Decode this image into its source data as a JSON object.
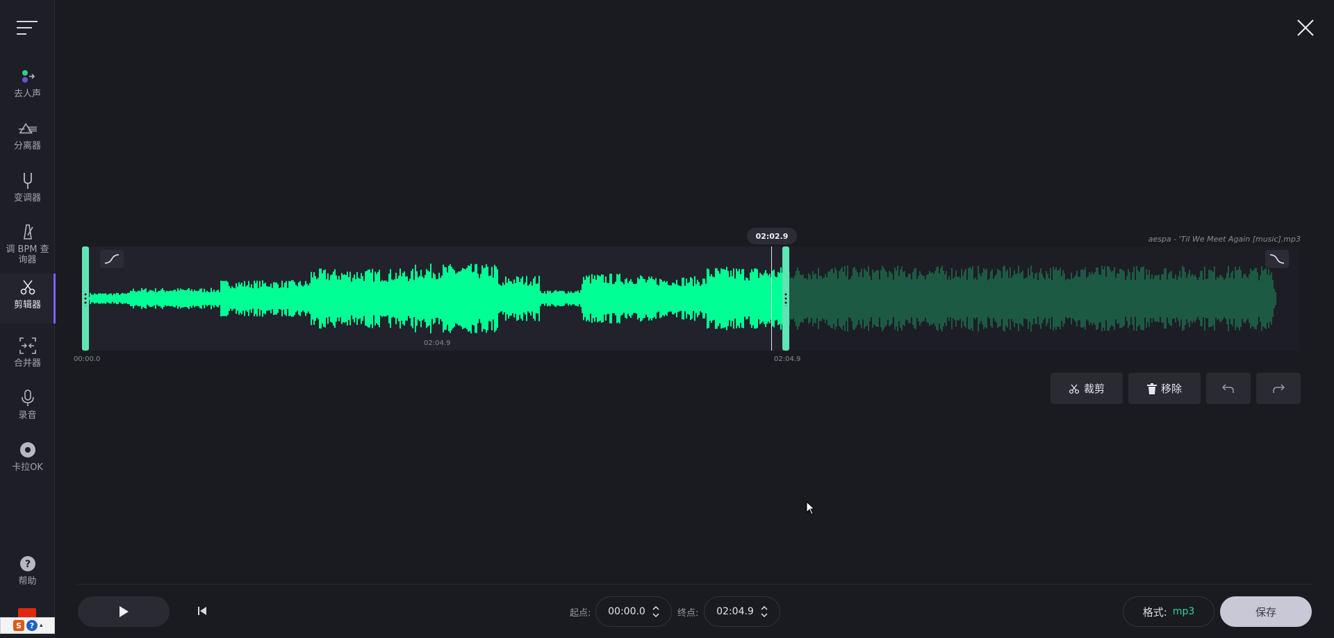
{
  "sidebar": {
    "items": [
      {
        "id": "vocal-remover",
        "label": "去人声",
        "icon": "vocal-split-icon"
      },
      {
        "id": "splitter",
        "label": "分离器",
        "icon": "prism-icon"
      },
      {
        "id": "pitch",
        "label": "变调器",
        "icon": "tuning-fork-icon"
      },
      {
        "id": "bpm",
        "label": "调 BPM 查询器",
        "icon": "metronome-icon"
      },
      {
        "id": "cutter",
        "label": "剪辑器",
        "icon": "scissors-icon"
      },
      {
        "id": "joiner",
        "label": "合并器",
        "icon": "merge-icon"
      },
      {
        "id": "recorder",
        "label": "录音",
        "icon": "microphone-icon"
      },
      {
        "id": "karaoke",
        "label": "卡拉OK",
        "icon": "record-disc-icon"
      }
    ],
    "help_label": "帮助"
  },
  "editor": {
    "file_name": "aespa - 'Til We Meet Again [music].mp3",
    "playhead_time": "02:02.9",
    "selection_duration": "02:04.9",
    "selection_start": "00:00.0",
    "selection_end": "02:04.9"
  },
  "actions": {
    "trim_label": "裁剪",
    "remove_label": "移除"
  },
  "transport": {
    "start_label": "起点:",
    "start_value": "00:00.0",
    "end_label": "终点:",
    "end_value": "02:04.9",
    "format_label": "格式:",
    "format_value": "mp3",
    "save_label": "保存"
  },
  "colors": {
    "accent_active": "#7b61ff",
    "wave_selected": "#00ff95",
    "wave_unselected": "#1d5a43",
    "handle": "#5fe4b4",
    "format_value": "#34d399"
  }
}
